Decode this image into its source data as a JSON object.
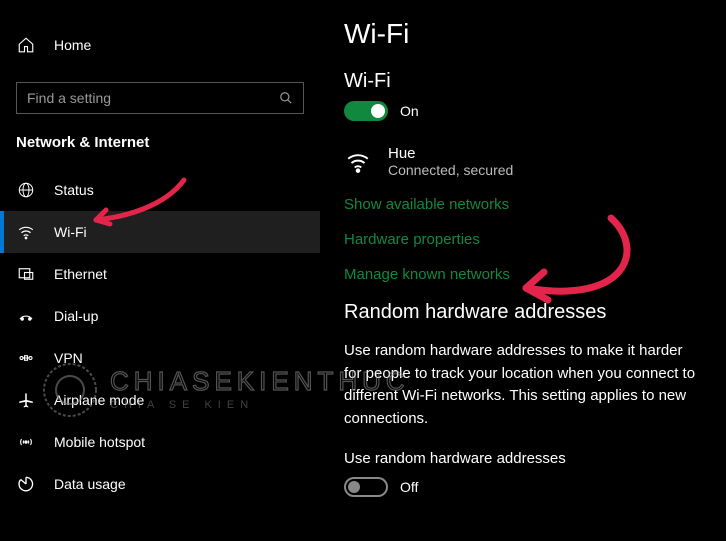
{
  "sidebar": {
    "home": "Home",
    "search_placeholder": "Find a setting",
    "section": "Network & Internet",
    "items": [
      {
        "label": "Status"
      },
      {
        "label": "Wi-Fi"
      },
      {
        "label": "Ethernet"
      },
      {
        "label": "Dial-up"
      },
      {
        "label": "VPN"
      },
      {
        "label": "Airplane mode"
      },
      {
        "label": "Mobile hotspot"
      },
      {
        "label": "Data usage"
      }
    ]
  },
  "main": {
    "title": "Wi-Fi",
    "wifi_heading": "Wi-Fi",
    "wifi_toggle_state": "On",
    "network": {
      "name": "Hue",
      "status": "Connected, secured"
    },
    "links": {
      "show_available": "Show available networks",
      "hardware_props": "Hardware properties",
      "manage_known": "Manage known networks"
    },
    "random_heading": "Random hardware addresses",
    "random_desc": "Use random hardware addresses to make it harder for people to track your location when you connect to different Wi-Fi networks. This setting applies to new connections.",
    "random_label": "Use random hardware addresses",
    "random_toggle_state": "Off"
  },
  "watermark": {
    "text": "CHIASEKIENTHUC",
    "subtitle": "CHIA SE KIEN"
  }
}
